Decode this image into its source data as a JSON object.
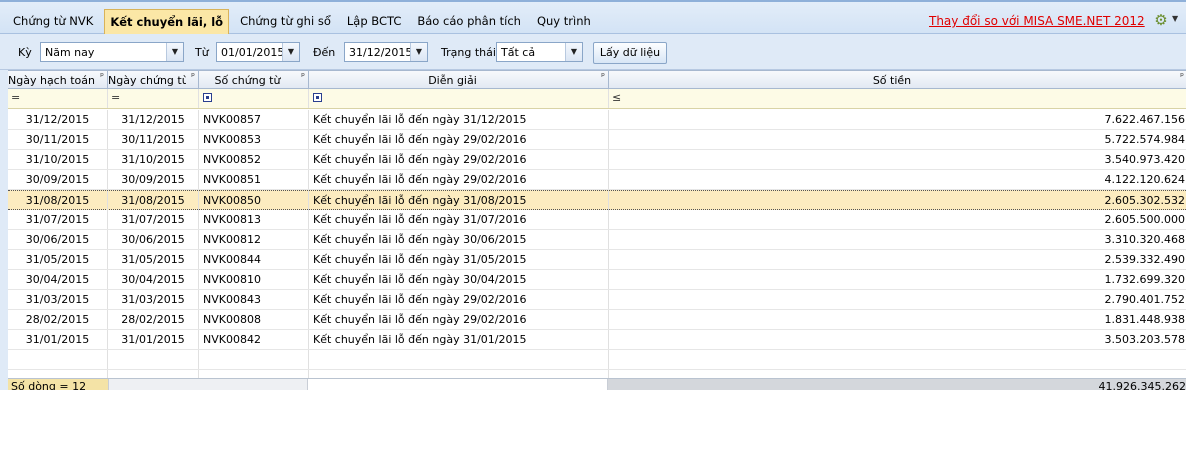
{
  "tabs": [
    {
      "label": "Chứng từ NVK",
      "active": false
    },
    {
      "label": "Kết chuyển lãi, lỗ",
      "active": true
    },
    {
      "label": "Chứng từ ghi sổ",
      "active": false
    },
    {
      "label": "Lập BCTC",
      "active": false
    },
    {
      "label": "Báo cáo phân tích",
      "active": false
    },
    {
      "label": "Quy trình",
      "active": false
    }
  ],
  "top_link": "Thay đổi so với MISA SME.NET 2012",
  "filters": {
    "period_label": "Kỳ",
    "period_value": "Năm nay",
    "from_label": "Từ",
    "from_value": "01/01/2015",
    "to_label": "Đến",
    "to_value": "31/12/2015",
    "status_label": "Trạng thái",
    "status_value": "Tất cả",
    "fetch_button": "Lấy dữ liệu"
  },
  "columns": {
    "posting_date": "Ngày hạch toán",
    "voucher_date": "Ngày chứng từ",
    "voucher_no": "Số chứng từ",
    "description": "Diễn giải",
    "amount": "Số tiền"
  },
  "filter_row": {
    "posting_date_op": "=",
    "voucher_date_op": "=",
    "amount_op": "≤"
  },
  "rows": [
    {
      "posting_date": "31/12/2015",
      "voucher_date": "31/12/2015",
      "voucher_no": "NVK00857",
      "description": "Kết chuyển lãi lỗ đến ngày 31/12/2015",
      "amount": "7.622.467.156"
    },
    {
      "posting_date": "30/11/2015",
      "voucher_date": "30/11/2015",
      "voucher_no": "NVK00853",
      "description": "Kết chuyển lãi lỗ đến ngày 29/02/2016",
      "amount": "5.722.574.984"
    },
    {
      "posting_date": "31/10/2015",
      "voucher_date": "31/10/2015",
      "voucher_no": "NVK00852",
      "description": "Kết chuyển lãi lỗ đến ngày 29/02/2016",
      "amount": "3.540.973.420"
    },
    {
      "posting_date": "30/09/2015",
      "voucher_date": "30/09/2015",
      "voucher_no": "NVK00851",
      "description": "Kết chuyển lãi lỗ đến ngày 29/02/2016",
      "amount": "4.122.120.624"
    },
    {
      "posting_date": "31/08/2015",
      "voucher_date": "31/08/2015",
      "voucher_no": "NVK00850",
      "description": "Kết chuyển lãi lỗ đến ngày 31/08/2015",
      "amount": "2.605.302.532",
      "selected": true
    },
    {
      "posting_date": "31/07/2015",
      "voucher_date": "31/07/2015",
      "voucher_no": "NVK00813",
      "description": "Kết chuyển lãi lỗ đến ngày 31/07/2016",
      "amount": "2.605.500.000"
    },
    {
      "posting_date": "30/06/2015",
      "voucher_date": "30/06/2015",
      "voucher_no": "NVK00812",
      "description": "Kết chuyển lãi lỗ đến ngày 30/06/2015",
      "amount": "3.310.320.468"
    },
    {
      "posting_date": "31/05/2015",
      "voucher_date": "31/05/2015",
      "voucher_no": "NVK00844",
      "description": "Kết chuyển lãi lỗ đến ngày 31/05/2015",
      "amount": "2.539.332.490"
    },
    {
      "posting_date": "30/04/2015",
      "voucher_date": "30/04/2015",
      "voucher_no": "NVK00810",
      "description": "Kết chuyển lãi lỗ đến ngày 30/04/2015",
      "amount": "1.732.699.320"
    },
    {
      "posting_date": "31/03/2015",
      "voucher_date": "31/03/2015",
      "voucher_no": "NVK00843",
      "description": "Kết chuyển lãi lỗ đến ngày 29/02/2016",
      "amount": "2.790.401.752"
    },
    {
      "posting_date": "28/02/2015",
      "voucher_date": "28/02/2015",
      "voucher_no": "NVK00808",
      "description": "Kết chuyển lãi lỗ đến ngày 29/02/2016",
      "amount": "1.831.448.938"
    },
    {
      "posting_date": "31/01/2015",
      "voucher_date": "31/01/2015",
      "voucher_no": "NVK00842",
      "description": "Kết chuyển lãi lỗ đến ngày 31/01/2015",
      "amount": "3.503.203.578"
    }
  ],
  "footer": {
    "row_count": "Số dòng = 12",
    "total_amount": "41.926.345.262"
  }
}
